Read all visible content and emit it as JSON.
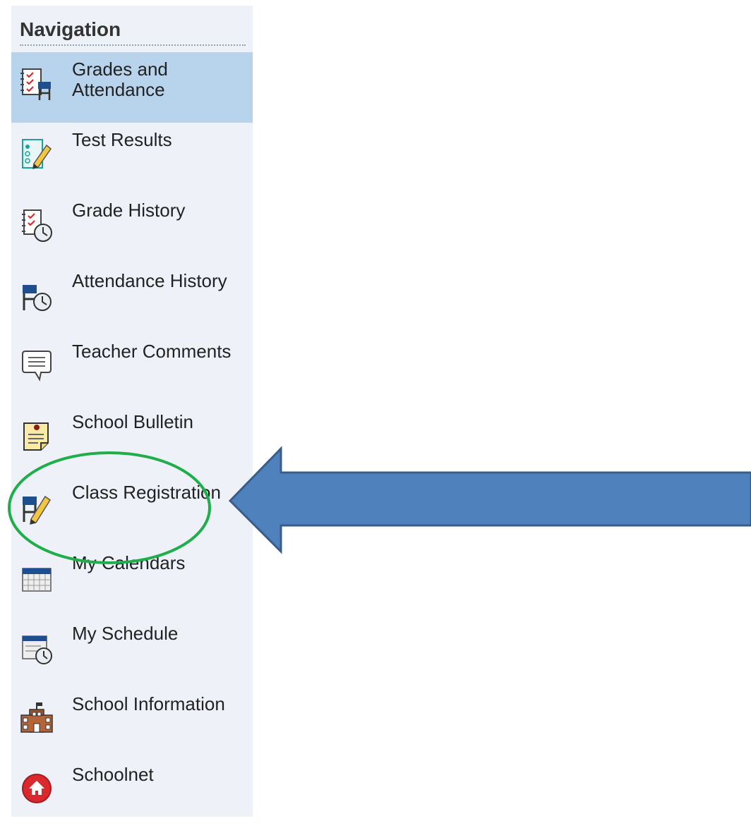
{
  "sidebar": {
    "title": "Navigation",
    "items": [
      {
        "label": "Grades and Attendance",
        "icon": "grades-attendance-icon",
        "active": true
      },
      {
        "label": "Test Results",
        "icon": "test-results-icon"
      },
      {
        "label": "Grade History",
        "icon": "grade-history-icon"
      },
      {
        "label": "Attendance History",
        "icon": "attendance-history-icon"
      },
      {
        "label": "Teacher Comments",
        "icon": "comment-bubble-icon"
      },
      {
        "label": "School Bulletin",
        "icon": "bulletin-icon"
      },
      {
        "label": "Class Registration",
        "icon": "class-registration-icon"
      },
      {
        "label": "My Calendars",
        "icon": "calendar-icon"
      },
      {
        "label": "My Schedule",
        "icon": "schedule-icon"
      },
      {
        "label": "School Information",
        "icon": "school-building-icon"
      },
      {
        "label": "Schoolnet",
        "icon": "schoolnet-home-icon"
      }
    ]
  },
  "annotation": {
    "highlight_color": "#1fae4a",
    "arrow_color": "#4f81bd",
    "arrow_outline": "#385d8a"
  }
}
